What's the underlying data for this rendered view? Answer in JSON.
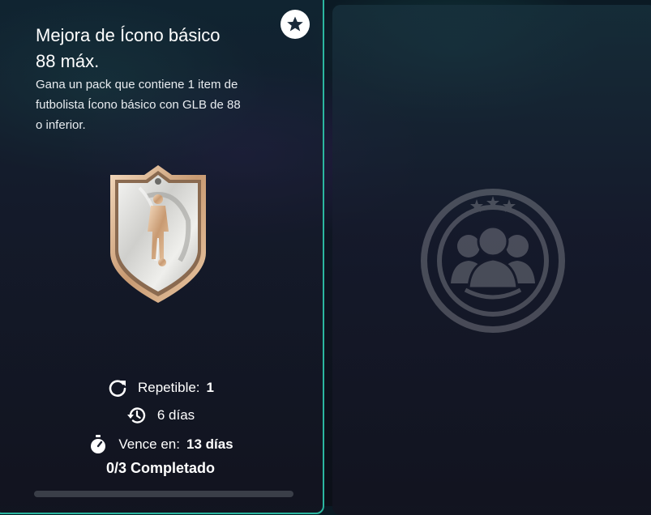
{
  "objective": {
    "title_line1": "Mejora de Ícono básico",
    "title_line2": "88 máx.",
    "description_line1": "Gana un pack que contiene 1 item de",
    "description_line2": "futbolista Ícono básico con GLB de 88",
    "description_line3": "o inferior.",
    "repeatable_label": "Repetible:",
    "repeatable_value": "1",
    "refresh_text": "6 días",
    "expires_label": "Vence en:",
    "expires_value": "13 días",
    "completion_text": "0/3 Completado",
    "progress_fraction": 0
  },
  "icons": {
    "favorite": "star-icon",
    "repeatable": "repeat-icon",
    "refresh": "history-icon",
    "expires": "stopwatch-icon",
    "reward": "icon-pack-badge",
    "locked_card": "players-emblem-icon"
  },
  "colors": {
    "accent_border": "#2bb6a0",
    "badge_gold": "#d9b48f",
    "text_primary": "#ffffff"
  }
}
